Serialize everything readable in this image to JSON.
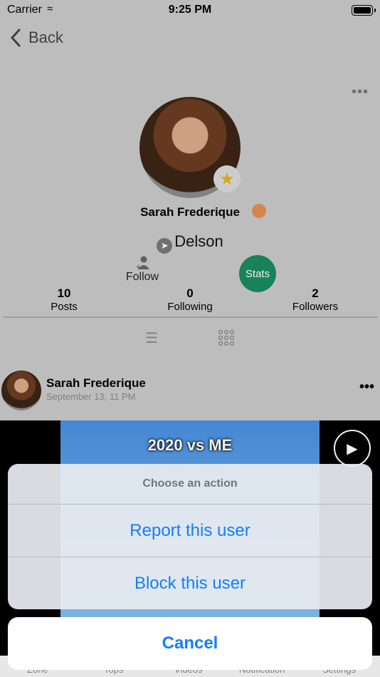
{
  "status_bar": {
    "carrier": "Carrier",
    "time": "9:25 PM"
  },
  "nav": {
    "back_label": "Back"
  },
  "profile": {
    "name": "Sarah Frederique",
    "location": "Delson",
    "follow_label": "Follow",
    "stats_label": "Stats",
    "counts": [
      {
        "value": "10",
        "label": "Posts"
      },
      {
        "value": "0",
        "label": "Following"
      },
      {
        "value": "2",
        "label": "Followers"
      }
    ]
  },
  "post": {
    "author": "Sarah Frederique",
    "date": "September 13, 11 PM",
    "video_title": "2020 vs ME"
  },
  "tabbar": {
    "items": [
      "Zone",
      "Tops",
      "Videos",
      "Notification",
      "Settings"
    ]
  },
  "action_sheet": {
    "title": "Choose an action",
    "actions": [
      "Report this user",
      "Block this user"
    ],
    "cancel": "Cancel"
  },
  "colors": {
    "accent": "#147efb",
    "stats": "#1a8a5f"
  }
}
